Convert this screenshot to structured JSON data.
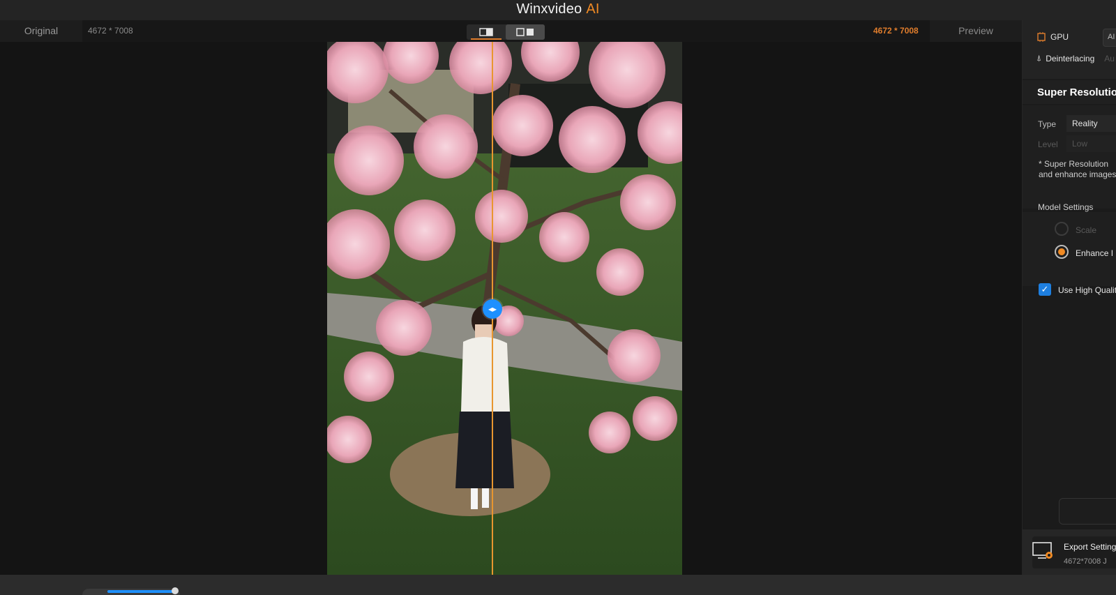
{
  "app": {
    "title_main": "Winxvideo",
    "title_accent": "AI",
    "accent_color": "#f08a24"
  },
  "viewer": {
    "original_label": "Original",
    "original_resolution": "4672 * 7008",
    "output_resolution": "4672 * 7008",
    "preview_label": "Preview",
    "compare_modes": [
      "split-view-icon",
      "side-by-side-icon"
    ]
  },
  "panel": {
    "gpu_label": "GPU",
    "gpu_value": "AI",
    "deinterlacing_label": "Deinterlacing",
    "deinterlacing_value": "Au",
    "section_title": "Super Resolutio",
    "type_label": "Type",
    "type_value": "Reality",
    "level_label": "Level",
    "level_value": "Low",
    "note_line1": "* Super Resolution",
    "note_line2": "and enhance images",
    "model_settings_label": "Model Settings",
    "scale_label": "Scale",
    "enhance_label": "Enhance I",
    "high_quality_label": "Use High Qualit",
    "export_title": "Export Setting",
    "export_sub": "4672*7008  J"
  }
}
